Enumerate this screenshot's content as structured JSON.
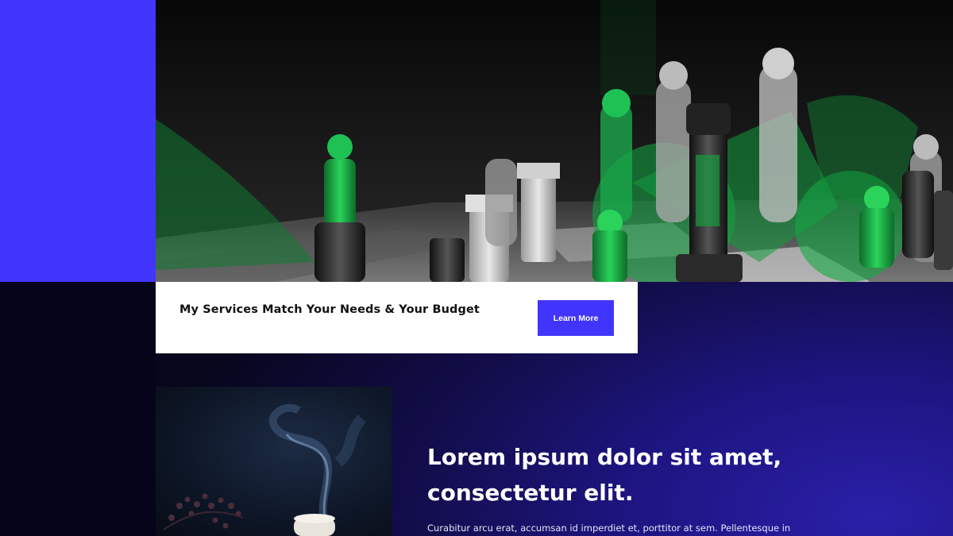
{
  "hero": {
    "image": "chess-pieces-photo",
    "accent_colors": {
      "blue": "#4235fb",
      "green": "#1fb84a"
    }
  },
  "card": {
    "title": "My Services Match Your Needs & Your Budget",
    "button_label": "Learn More"
  },
  "feature": {
    "image": "incense-smoke-photo",
    "headline_line1": "Lorem ipsum dolor sit amet,",
    "headline_line2": "consectetur elit.",
    "paragraph": "Curabitur arcu erat, accumsan id imperdiet et, porttitor at sem. Pellentesque in"
  }
}
